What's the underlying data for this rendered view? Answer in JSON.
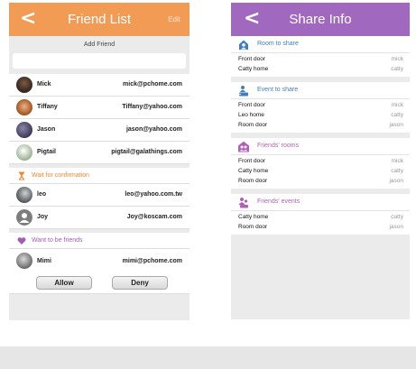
{
  "friend_list": {
    "back_glyph": "<",
    "title": "Friend List",
    "edit_label": "Edit",
    "add_friend_label": "Add Friend",
    "add_friend_value": "",
    "friends": [
      {
        "name": "Mick",
        "email": "mick@pchome.com"
      },
      {
        "name": "Tiffany",
        "email": "Tiffany@yahoo.com"
      },
      {
        "name": "Jason",
        "email": "jason@yahoo.com"
      },
      {
        "name": "Pigtail",
        "email": "pigtail@galathings.com"
      }
    ],
    "waiting": {
      "label": "Wait for confirmation",
      "items": [
        {
          "name": "leo",
          "email": "leo@yahoo.com.tw"
        },
        {
          "name": "Joy",
          "email": "Joy@koscam.com"
        }
      ]
    },
    "want": {
      "label": "Want to be friends",
      "items": [
        {
          "name": "Mimi",
          "email": "mimi@pchome.com",
          "allow_label": "Allow",
          "deny_label": "Deny"
        }
      ]
    }
  },
  "share_info": {
    "back_glyph": "<",
    "title": "Share Info",
    "groups": [
      {
        "label": "Room to share",
        "icon": "room-icon",
        "rows": [
          {
            "name": "Front door",
            "owner": "mick"
          },
          {
            "name": "Catty home",
            "owner": "catty"
          }
        ]
      },
      {
        "label": "Event to share",
        "icon": "event-icon",
        "rows": [
          {
            "name": "Front door",
            "owner": "mick"
          },
          {
            "name": "Leo home",
            "owner": "catty"
          },
          {
            "name": "Room  door",
            "owner": "jason"
          }
        ]
      },
      {
        "label": "Friends' rooms",
        "icon": "friends-rooms-icon",
        "rows": [
          {
            "name": "Front door",
            "owner": "mick"
          },
          {
            "name": "Catty home",
            "owner": "catty"
          },
          {
            "name": "Room  door",
            "owner": "jason"
          }
        ]
      },
      {
        "label": "Friends' events",
        "icon": "friends-events-icon",
        "rows": [
          {
            "name": "Catty home",
            "owner": "catty"
          },
          {
            "name": "Room  door",
            "owner": "jason"
          }
        ]
      }
    ]
  },
  "colors": {
    "friend_header": "#f29b55",
    "share_header": "#a069bf",
    "wait_accent": "#f08a2e",
    "want_accent": "#a25eb7",
    "share_blue": "#3f7fc2"
  }
}
